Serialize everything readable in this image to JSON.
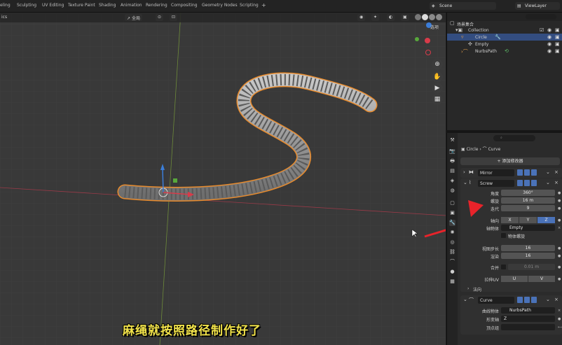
{
  "topbar": {
    "tabs": [
      "eling",
      "Sculpting",
      "UV Editing",
      "Texture Paint",
      "Shading",
      "Animation",
      "Rendering",
      "Compositing",
      "Geometry Nodes",
      "Scripting"
    ],
    "plus": "+",
    "scene": "Scene",
    "view_layer": "ViewLayer"
  },
  "viewport": {
    "mode_label": "ics",
    "transform_orientation": "全局",
    "options_label": "选项",
    "subtitle": "麻绳就按照路径制作好了"
  },
  "outliner": {
    "title": "场景集合",
    "rows": [
      {
        "label": "Collection"
      },
      {
        "label": "Circle"
      },
      {
        "label": "Empty"
      },
      {
        "label": "NurbsPath"
      }
    ]
  },
  "properties": {
    "breadcrumb_object": "Circle",
    "breadcrumb_data": "Curve",
    "add_modifier": "添加修改器",
    "mirror": {
      "name": "Mirror"
    },
    "screw": {
      "name": "Screw",
      "angle_label": "角度",
      "angle_value": "360°",
      "screw_label": "螺旋",
      "screw_value": "16 m",
      "iterations_label": "迭代",
      "iterations_value": "9",
      "axis_label": "轴向",
      "axes": [
        "X",
        "Y",
        "Z"
      ],
      "active_axis": "Z",
      "axis_object_label": "轴物体",
      "axis_object_value": "Empty",
      "object_screw_label": "物体螺旋",
      "steps_viewport_label": "视图步长",
      "steps_viewport_value": "16",
      "render_label": "渲染",
      "render_value": "16",
      "merge_label": "合并",
      "merge_value": "0.01 m",
      "stretch_label": "拉伸UV",
      "stretch_u": "U",
      "stretch_v": "V",
      "normals_label": "法向"
    },
    "curve": {
      "name": "Curve",
      "curve_object_label": "曲线物体",
      "curve_object_value": "NurbsPath",
      "deform_axis_label": "形变轴",
      "deform_axis_value": "Z",
      "vertex_group_label": "顶点组"
    }
  },
  "colors": {
    "accent_blue": "#4a72b8",
    "selection_orange": "#e88b2d",
    "subtitle_yellow": "#f2e34b",
    "arrow_red": "#e8232a"
  }
}
